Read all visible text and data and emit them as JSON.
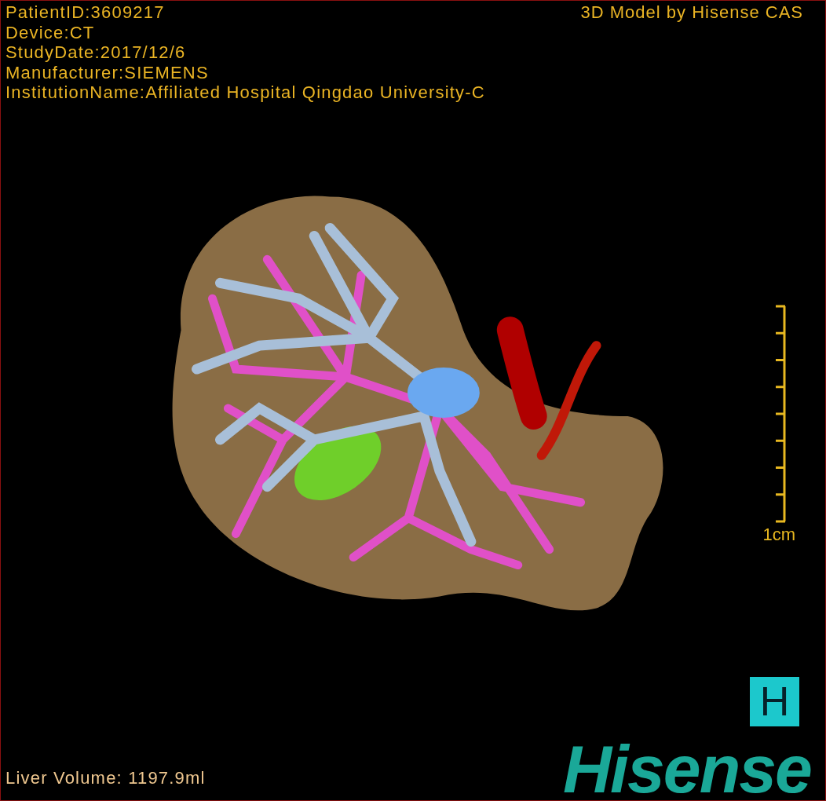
{
  "header": {
    "info_lines": [
      "PatientID:3609217",
      "Device:CT",
      "StudyDate:2017/12/6",
      "Manufacturer:SIEMENS",
      "InstitutionName:Affiliated Hospital Qingdao University-C"
    ],
    "title": "3D Model by Hisense CAS"
  },
  "scale": {
    "label": "1cm"
  },
  "footer": {
    "volume": "Liver Volume: 1197.9ml",
    "badge": "H",
    "brand": "Hisense"
  }
}
